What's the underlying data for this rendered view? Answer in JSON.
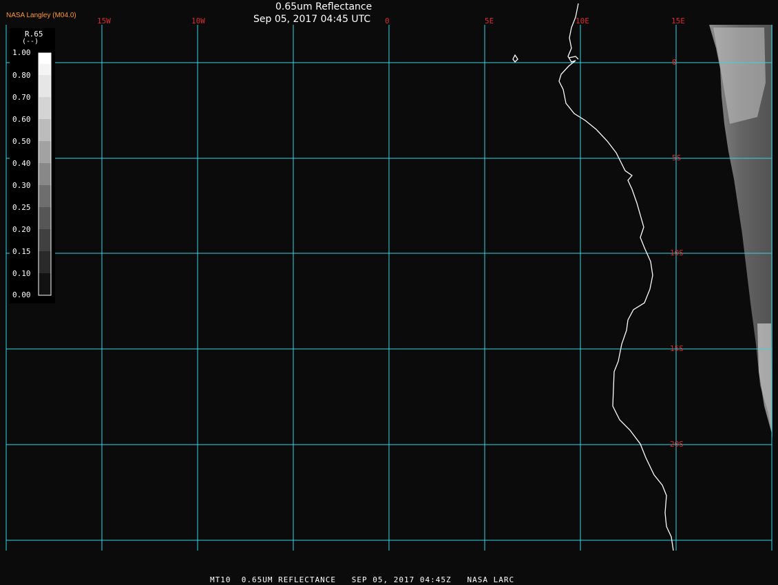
{
  "header": {
    "agency": "NASA Langley (M04.0)",
    "title": "0.65um Reflectance",
    "datetime": "Sep 05, 2017 04:45 UTC"
  },
  "map": {
    "longitude_labels": [
      "15W",
      "10W",
      "0",
      "5E",
      "10E",
      "15E"
    ],
    "latitude_labels": [
      "0",
      "5S",
      "10S",
      "15S",
      "20S"
    ],
    "grid_color": "#33d6e6",
    "label_color": "#d43030",
    "coast_color": "#ffffff"
  },
  "legend": {
    "variable": "R.65",
    "unit": "(--)",
    "unit_prefix": "(%)",
    "ticks": [
      "1.00",
      "0.80",
      "0.70",
      "0.60",
      "0.50",
      "0.40",
      "0.30",
      "0.25",
      "0.20",
      "0.15",
      "0.10",
      "0.00"
    ]
  },
  "footer": {
    "text": "MT10  0.65UM REFLECTANCE   SEP 05, 2017 04:45Z   NASA LARC"
  }
}
